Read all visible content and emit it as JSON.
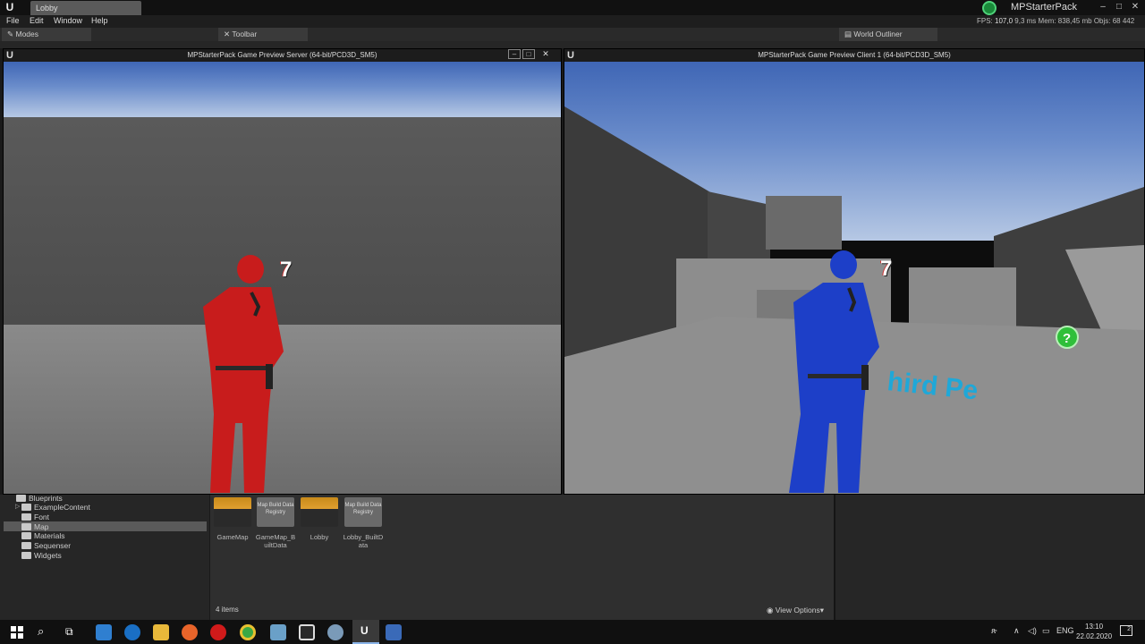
{
  "titlebar": {
    "tab_label": "Lobby",
    "project_name": "MPStarterPack"
  },
  "menu": [
    "File",
    "Edit",
    "Window",
    "Help"
  ],
  "stats": {
    "fps_label": "FPS:",
    "fps_value": "107,0",
    "ms": "9,3 ms",
    "mem_label": "Mem:",
    "mem_value": "838,45 mb",
    "objs_label": "Objs:",
    "objs_value": "68 442"
  },
  "panel_tabs": {
    "modes": "Modes",
    "toolbar": "Toolbar",
    "world_outliner": "World Outliner"
  },
  "viewport_server": {
    "title": "MPStarterPack Game Preview Server (64-bit/PCD3D_SM5)",
    "ammo": "7",
    "character_color": "#c81c1c"
  },
  "viewport_client": {
    "title": "MPStarterPack Game Preview Client 1 (64-bit/PCD3D_SM5)",
    "ammo": "7",
    "floor_text": "hird Pe",
    "character_color": "#1d3fc8"
  },
  "folders": [
    "Blueprints",
    "ExampleContent",
    "Font",
    "Map",
    "Materials",
    "Sequenser",
    "Widgets"
  ],
  "selected_folder": "Map",
  "assets": [
    {
      "name": "GameMap",
      "kind": "map"
    },
    {
      "name": "GameMap_BuiltData",
      "kind": "registry",
      "thumb": "Map Build Data Registry"
    },
    {
      "name": "Lobby",
      "kind": "map"
    },
    {
      "name": "Lobby_BuiltData",
      "kind": "registry",
      "thumb": "Map Build Data Registry"
    }
  ],
  "item_count": "4 items",
  "view_options": "View Options",
  "taskbar": {
    "lang": "ENG",
    "time": "13:10",
    "date": "22.02.2020",
    "notifications": "2"
  },
  "colors": {
    "accent_green": "#4fd27a",
    "sky_blue": "#3f66b5",
    "floor_cyan": "#1fa8d8"
  }
}
